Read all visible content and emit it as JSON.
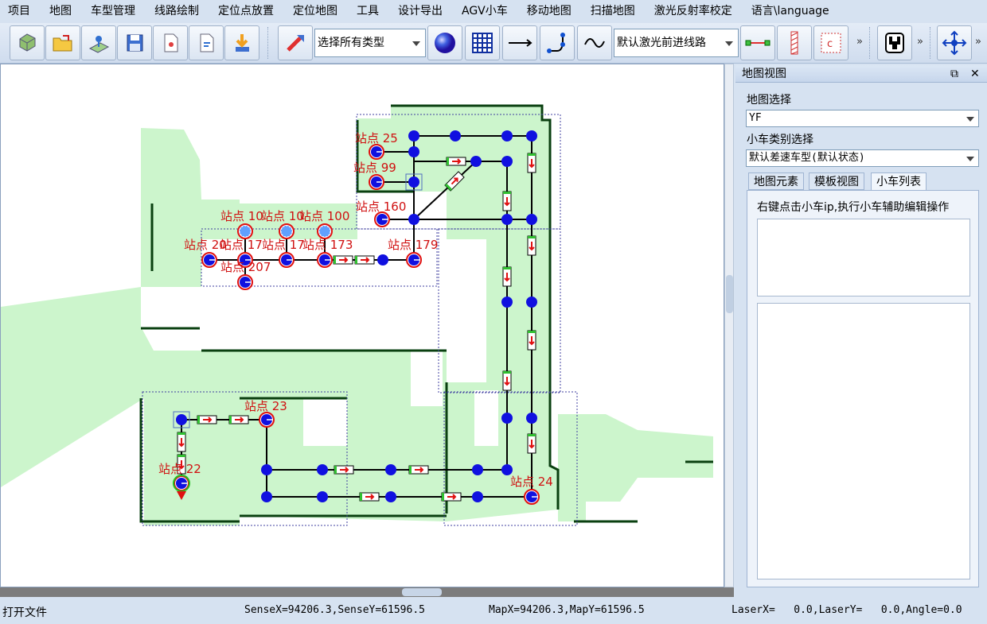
{
  "menu": [
    "项目",
    "地图",
    "车型管理",
    "线路绘制",
    "定位点放置",
    "定位地图",
    "工具",
    "设计导出",
    "AGV小车",
    "移动地图",
    "扫描地图",
    "激光反射率校定",
    "语言\\language"
  ],
  "toolbar": {
    "type_select": "选择所有类型",
    "line_select": "默认激光前进线路",
    "more": "»"
  },
  "panel": {
    "title": "地图视图",
    "map_label": "地图选择",
    "map_value": "YF",
    "car_type_label": "小车类别选择",
    "car_type_value": "默认差速车型(默认状态)",
    "tabs": [
      "地图元素",
      "模板视图",
      "小车列表"
    ],
    "active_tab": "小车列表",
    "hint": "右键点击小车ip,执行小车辅助编辑操作"
  },
  "status": {
    "left": "打开文件",
    "sense": "SenseX=94206.3,SenseY=61596.5",
    "map": "MapX=94206.3,MapY=61596.5",
    "laser": "LaserX=   0.0,LaserY=   0.0,Angle=0.0"
  },
  "stations": [
    {
      "label": "站点 25"
    },
    {
      "label": "站点 99"
    },
    {
      "label": "站点 160"
    },
    {
      "label": "站点 10"
    },
    {
      "label": "站点 10"
    },
    {
      "label": "站点 100"
    },
    {
      "label": "站点 20"
    },
    {
      "label": "站点 17"
    },
    {
      "label": "站点 17"
    },
    {
      "label": "站点 173"
    },
    {
      "label": "站点 179"
    },
    {
      "label": "站点 207"
    },
    {
      "label": "站点 23"
    },
    {
      "label": "站点 22"
    },
    {
      "label": "站点 24"
    }
  ],
  "colors": {
    "map_floor": "#ccf5cc",
    "path_node": "#1010e0",
    "station_ring": "#e01010",
    "label_red": "#d01010",
    "dashed_region": "#4040a0"
  }
}
